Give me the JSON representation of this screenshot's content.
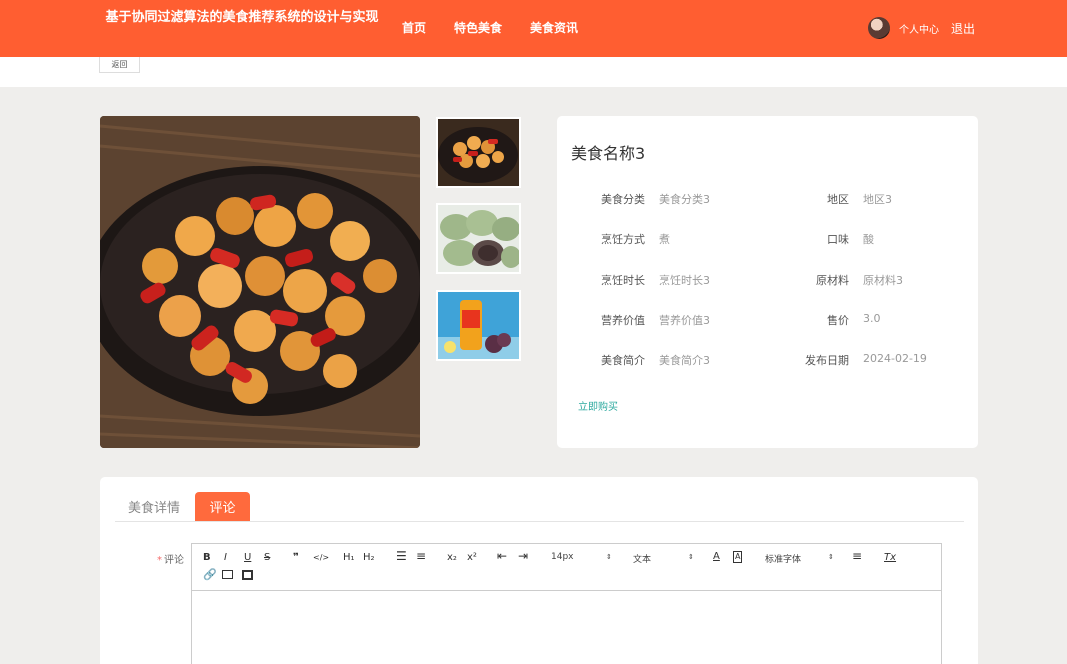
{
  "header": {
    "site_title": "基于协同过滤算法的美食推荐系统的设计与实现",
    "nav": [
      "首页",
      "特色美食",
      "美食资讯"
    ],
    "user_center": "个人中心",
    "logout": "退出"
  },
  "back_label": "返回",
  "food": {
    "name": "美食名称3",
    "fields": [
      {
        "label": "美食分类",
        "value": "美食分类3"
      },
      {
        "label": "地区",
        "value": "地区3"
      },
      {
        "label": "烹饪方式",
        "value": "煮"
      },
      {
        "label": "口味",
        "value": "酸"
      },
      {
        "label": "烹饪时长",
        "value": "烹饪时长3"
      },
      {
        "label": "原材料",
        "value": "原材料3"
      },
      {
        "label": "营养价值",
        "value": "营养价值3"
      },
      {
        "label": "售价",
        "value": "3.0"
      },
      {
        "label": "美食简介",
        "value": "美食简介3"
      },
      {
        "label": "发布日期",
        "value": "2024-02-19"
      }
    ],
    "buy_label": "立即购买"
  },
  "tabs": [
    {
      "label": "美食详情",
      "active": false
    },
    {
      "label": "评论",
      "active": true
    }
  ],
  "comment": {
    "required_mark": "*",
    "label": "评论",
    "toolbar": {
      "bold": "B",
      "italic": "I",
      "underline": "U",
      "strike": "S",
      "quote": "❞",
      "code": "</>",
      "h1": "H₁",
      "h2": "H₂",
      "subscript": "x₂",
      "superscript": "x²",
      "size": "14px",
      "text_type": "文本",
      "font": "标准字体",
      "clear": "Tx"
    }
  },
  "colors": {
    "header_bg": "#ff5e31",
    "tab_active": "#ff6a3d",
    "buy_link": "#2eaa9f"
  }
}
